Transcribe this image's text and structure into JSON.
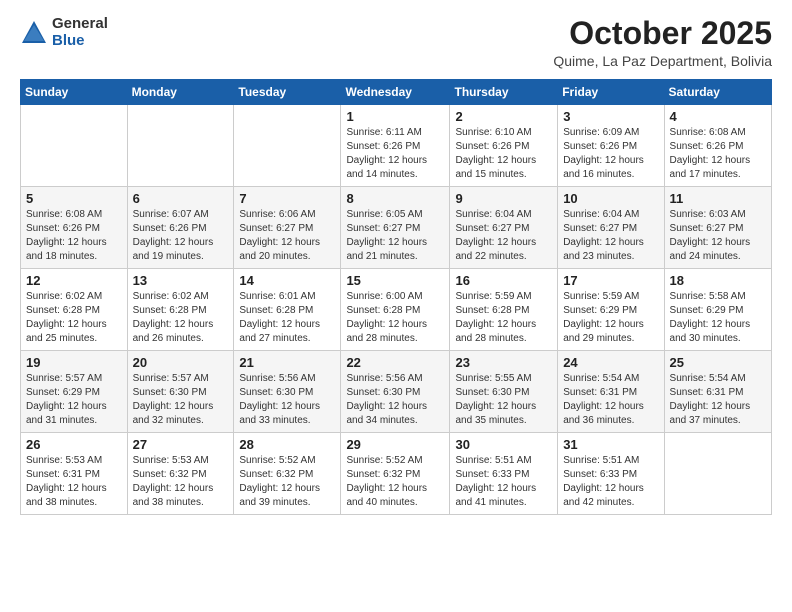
{
  "header": {
    "logo": {
      "general": "General",
      "blue": "Blue"
    },
    "title": "October 2025",
    "location": "Quime, La Paz Department, Bolivia"
  },
  "calendar": {
    "days_of_week": [
      "Sunday",
      "Monday",
      "Tuesday",
      "Wednesday",
      "Thursday",
      "Friday",
      "Saturday"
    ],
    "weeks": [
      [
        {
          "day": "",
          "info": ""
        },
        {
          "day": "",
          "info": ""
        },
        {
          "day": "",
          "info": ""
        },
        {
          "day": "1",
          "info": "Sunrise: 6:11 AM\nSunset: 6:26 PM\nDaylight: 12 hours\nand 14 minutes."
        },
        {
          "day": "2",
          "info": "Sunrise: 6:10 AM\nSunset: 6:26 PM\nDaylight: 12 hours\nand 15 minutes."
        },
        {
          "day": "3",
          "info": "Sunrise: 6:09 AM\nSunset: 6:26 PM\nDaylight: 12 hours\nand 16 minutes."
        },
        {
          "day": "4",
          "info": "Sunrise: 6:08 AM\nSunset: 6:26 PM\nDaylight: 12 hours\nand 17 minutes."
        }
      ],
      [
        {
          "day": "5",
          "info": "Sunrise: 6:08 AM\nSunset: 6:26 PM\nDaylight: 12 hours\nand 18 minutes."
        },
        {
          "day": "6",
          "info": "Sunrise: 6:07 AM\nSunset: 6:26 PM\nDaylight: 12 hours\nand 19 minutes."
        },
        {
          "day": "7",
          "info": "Sunrise: 6:06 AM\nSunset: 6:27 PM\nDaylight: 12 hours\nand 20 minutes."
        },
        {
          "day": "8",
          "info": "Sunrise: 6:05 AM\nSunset: 6:27 PM\nDaylight: 12 hours\nand 21 minutes."
        },
        {
          "day": "9",
          "info": "Sunrise: 6:04 AM\nSunset: 6:27 PM\nDaylight: 12 hours\nand 22 minutes."
        },
        {
          "day": "10",
          "info": "Sunrise: 6:04 AM\nSunset: 6:27 PM\nDaylight: 12 hours\nand 23 minutes."
        },
        {
          "day": "11",
          "info": "Sunrise: 6:03 AM\nSunset: 6:27 PM\nDaylight: 12 hours\nand 24 minutes."
        }
      ],
      [
        {
          "day": "12",
          "info": "Sunrise: 6:02 AM\nSunset: 6:28 PM\nDaylight: 12 hours\nand 25 minutes."
        },
        {
          "day": "13",
          "info": "Sunrise: 6:02 AM\nSunset: 6:28 PM\nDaylight: 12 hours\nand 26 minutes."
        },
        {
          "day": "14",
          "info": "Sunrise: 6:01 AM\nSunset: 6:28 PM\nDaylight: 12 hours\nand 27 minutes."
        },
        {
          "day": "15",
          "info": "Sunrise: 6:00 AM\nSunset: 6:28 PM\nDaylight: 12 hours\nand 28 minutes."
        },
        {
          "day": "16",
          "info": "Sunrise: 5:59 AM\nSunset: 6:28 PM\nDaylight: 12 hours\nand 28 minutes."
        },
        {
          "day": "17",
          "info": "Sunrise: 5:59 AM\nSunset: 6:29 PM\nDaylight: 12 hours\nand 29 minutes."
        },
        {
          "day": "18",
          "info": "Sunrise: 5:58 AM\nSunset: 6:29 PM\nDaylight: 12 hours\nand 30 minutes."
        }
      ],
      [
        {
          "day": "19",
          "info": "Sunrise: 5:57 AM\nSunset: 6:29 PM\nDaylight: 12 hours\nand 31 minutes."
        },
        {
          "day": "20",
          "info": "Sunrise: 5:57 AM\nSunset: 6:30 PM\nDaylight: 12 hours\nand 32 minutes."
        },
        {
          "day": "21",
          "info": "Sunrise: 5:56 AM\nSunset: 6:30 PM\nDaylight: 12 hours\nand 33 minutes."
        },
        {
          "day": "22",
          "info": "Sunrise: 5:56 AM\nSunset: 6:30 PM\nDaylight: 12 hours\nand 34 minutes."
        },
        {
          "day": "23",
          "info": "Sunrise: 5:55 AM\nSunset: 6:30 PM\nDaylight: 12 hours\nand 35 minutes."
        },
        {
          "day": "24",
          "info": "Sunrise: 5:54 AM\nSunset: 6:31 PM\nDaylight: 12 hours\nand 36 minutes."
        },
        {
          "day": "25",
          "info": "Sunrise: 5:54 AM\nSunset: 6:31 PM\nDaylight: 12 hours\nand 37 minutes."
        }
      ],
      [
        {
          "day": "26",
          "info": "Sunrise: 5:53 AM\nSunset: 6:31 PM\nDaylight: 12 hours\nand 38 minutes."
        },
        {
          "day": "27",
          "info": "Sunrise: 5:53 AM\nSunset: 6:32 PM\nDaylight: 12 hours\nand 38 minutes."
        },
        {
          "day": "28",
          "info": "Sunrise: 5:52 AM\nSunset: 6:32 PM\nDaylight: 12 hours\nand 39 minutes."
        },
        {
          "day": "29",
          "info": "Sunrise: 5:52 AM\nSunset: 6:32 PM\nDaylight: 12 hours\nand 40 minutes."
        },
        {
          "day": "30",
          "info": "Sunrise: 5:51 AM\nSunset: 6:33 PM\nDaylight: 12 hours\nand 41 minutes."
        },
        {
          "day": "31",
          "info": "Sunrise: 5:51 AM\nSunset: 6:33 PM\nDaylight: 12 hours\nand 42 minutes."
        },
        {
          "day": "",
          "info": ""
        }
      ]
    ]
  }
}
